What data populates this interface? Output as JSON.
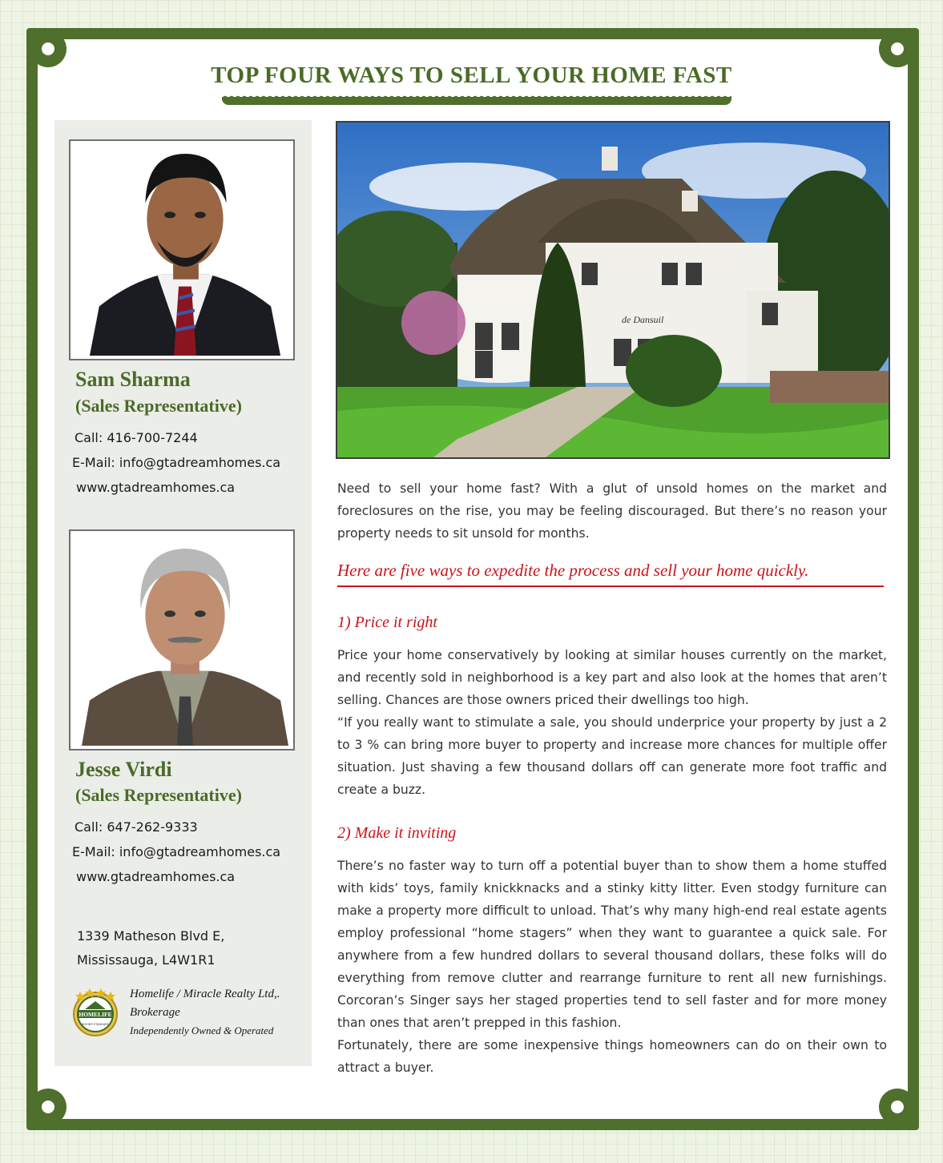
{
  "title": "TOP FOUR WAYS TO SELL YOUR HOME FAST",
  "agents": [
    {
      "name": "Sam Sharma",
      "role": "(Sales Representative)",
      "call": "Call: 416-700-7244",
      "email": "E-Mail: info@gtadreamhomes.ca",
      "web": "www.gtadreamhomes.ca"
    },
    {
      "name": "Jesse Virdi",
      "role": "(Sales Representative)",
      "call": "Call: 647-262-9333",
      "email": "E-Mail: info@gtadreamhomes.ca",
      "web": "www.gtadreamhomes.ca"
    }
  ],
  "address": {
    "line1": "1339 Matheson Blvd E,",
    "line2": "Mississauga, L4W1R1"
  },
  "brokerage": {
    "line1": "Homelife / Miracle Realty Ltd,.",
    "line2": "Brokerage",
    "line3": "Independently Owned & Operated",
    "logo_text": "HOMELIFE",
    "logo_sub": "HIGHER STANDARD"
  },
  "house_sign": "de Dansuil",
  "intro": "Need to sell your home fast? With a glut of unsold homes on the market and foreclosures on the rise, you may be feeling discouraged. But there’s no reason your property needs to sit unsold for months.",
  "highlight": "Here are five ways to expedite the process and sell your home quickly.",
  "sections": [
    {
      "heading": "1) Price it right",
      "paragraphs": [
        "Price your home conservatively by looking at similar houses currently on the market, and recently sold in neighborhood is a key part and also look at the homes that aren’t selling. Chances are those owners priced their dwellings too high.",
        "“If you really want to stimulate a sale, you should underprice your property by just a 2 to 3 % can bring more buyer to property and increase more chances for multiple offer situation. Just shaving a few thousand dollars off can generate more foot traffic and create a buzz."
      ]
    },
    {
      "heading": "2) Make it inviting",
      "paragraphs": [
        "There’s no faster way to turn off a potential buyer than to show them a home stuffed with kids’ toys, family knickknacks and a stinky kitty litter. Even stodgy furniture can make a property more difficult to unload. That’s why many high-end real estate agents employ professional “home stagers” when they want to guarantee a quick sale. For anywhere from a few hundred dollars to several thousand dollars, these folks will do everything from remove clutter and rearrange furniture to rent all new furnishings. Corcoran’s Singer says her staged properties tend to sell faster and for more money than ones that aren’t prepped in this fashion.",
        "Fortunately, there are some inexpensive things homeowners can do on their own to attract a buyer."
      ]
    }
  ],
  "colors": {
    "frame_green": "#4f6f2c",
    "title_green": "#4a6b27",
    "accent_red": "#c8141b",
    "sidebar_bg": "#ebede8"
  }
}
